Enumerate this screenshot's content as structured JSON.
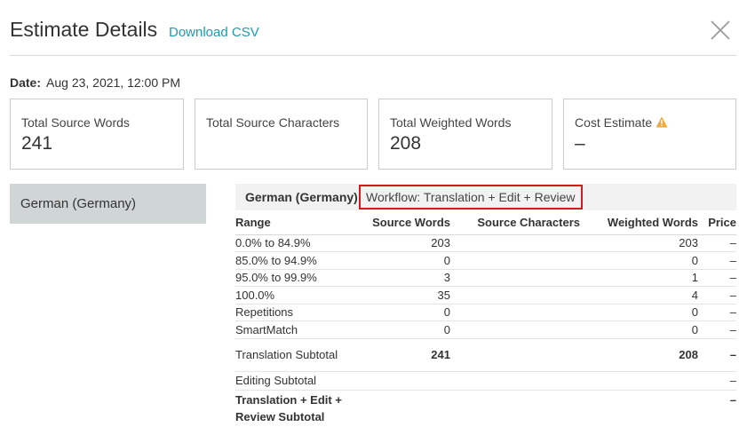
{
  "header": {
    "title": "Estimate Details",
    "download_label": "Download CSV"
  },
  "date": {
    "label": "Date:",
    "value": "Aug 23, 2021, 12:00 PM"
  },
  "cards": {
    "source_words": {
      "label": "Total Source Words",
      "value": "241"
    },
    "source_characters": {
      "label": "Total Source Characters",
      "value": ""
    },
    "weighted_words": {
      "label": "Total Weighted Words",
      "value": "208"
    },
    "cost_estimate": {
      "label": "Cost Estimate",
      "value": "–",
      "icon": "warning-icon",
      "icon_color": "#f0a838"
    }
  },
  "languages": [
    {
      "label": "German (Germany)"
    }
  ],
  "detail": {
    "language": "German (Germany)",
    "workflow": "Workflow: Translation + Edit + Review",
    "highlight_color": "#d41a1a",
    "columns": {
      "range": "Range",
      "source_words": "Source Words",
      "source_characters": "Source Characters",
      "weighted_words": "Weighted Words",
      "price": "Price"
    },
    "rows": [
      {
        "range": "0.0% to 84.9%",
        "source_words": "203",
        "weighted_words": "203",
        "price": "–"
      },
      {
        "range": "85.0% to 94.9%",
        "source_words": "0",
        "weighted_words": "0",
        "price": "–"
      },
      {
        "range": "95.0% to 99.9%",
        "source_words": "3",
        "weighted_words": "1",
        "price": "–"
      },
      {
        "range": "100.0%",
        "source_words": "35",
        "weighted_words": "4",
        "price": "–"
      },
      {
        "range": "Repetitions",
        "source_words": "0",
        "weighted_words": "0",
        "price": "–"
      },
      {
        "range": "SmartMatch",
        "source_words": "0",
        "weighted_words": "0",
        "price": "–"
      }
    ],
    "translation_subtotal": {
      "label": "Translation Subtotal",
      "source_words": "241",
      "weighted_words": "208",
      "price": "–"
    },
    "editing_subtotal": {
      "label": "Editing Subtotal",
      "price": "–"
    },
    "workflow_subtotal": {
      "label": "Translation + Edit + Review Subtotal",
      "price": "–"
    }
  },
  "colors": {
    "accent": "#1a9cb0",
    "selected_language_bg": "#d0d5d6"
  }
}
